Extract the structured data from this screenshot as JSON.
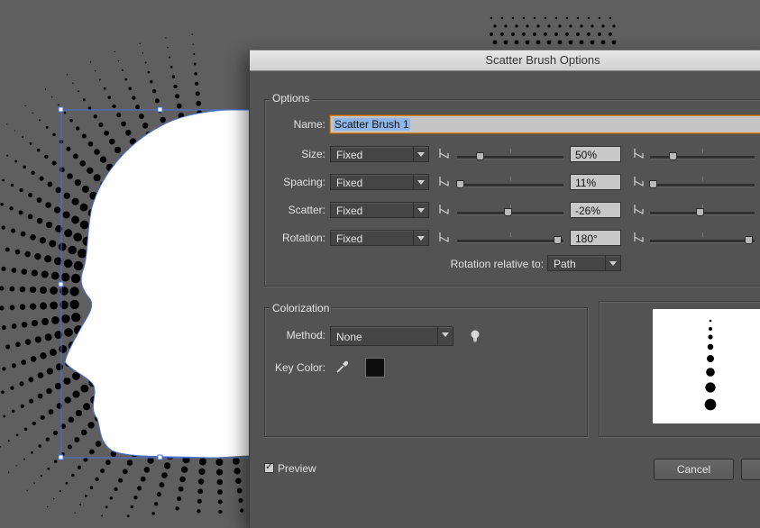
{
  "dialog": {
    "title": "Scatter Brush Options",
    "options_group": {
      "legend": "Options",
      "name_label": "Name:",
      "name_value": "Scatter Brush 1",
      "rows": [
        {
          "label": "Size:",
          "mode": "Fixed",
          "value": "50%",
          "slider_pos": 0.22,
          "second_slider_pos": 0.22
        },
        {
          "label": "Spacing:",
          "mode": "Fixed",
          "value": "11%",
          "slider_pos": 0.03,
          "second_slider_pos": 0.03
        },
        {
          "label": "Scatter:",
          "mode": "Fixed",
          "value": "-26%",
          "slider_pos": 0.49,
          "second_slider_pos": 0.49
        },
        {
          "label": "Rotation:",
          "mode": "Fixed",
          "value": "180°",
          "slider_pos": 0.97,
          "second_slider_pos": 0.97
        }
      ],
      "rotation_relative_label": "Rotation relative to:",
      "rotation_relative_value": "Path"
    },
    "colorization": {
      "legend": "Colorization",
      "method_label": "Method:",
      "method_value": "None",
      "key_color_label": "Key Color:",
      "key_color": "#0d0d0d",
      "tips_icon": "lightbulb-icon",
      "eyedropper_icon": "eyedropper-icon"
    },
    "preview_label": "Preview",
    "preview_checked": true,
    "cancel_label": "Cancel"
  },
  "colors": {
    "canvas_bg": "#5f5f5f",
    "dialog_bg": "#535353",
    "selection_blue": "#4a74d8"
  }
}
